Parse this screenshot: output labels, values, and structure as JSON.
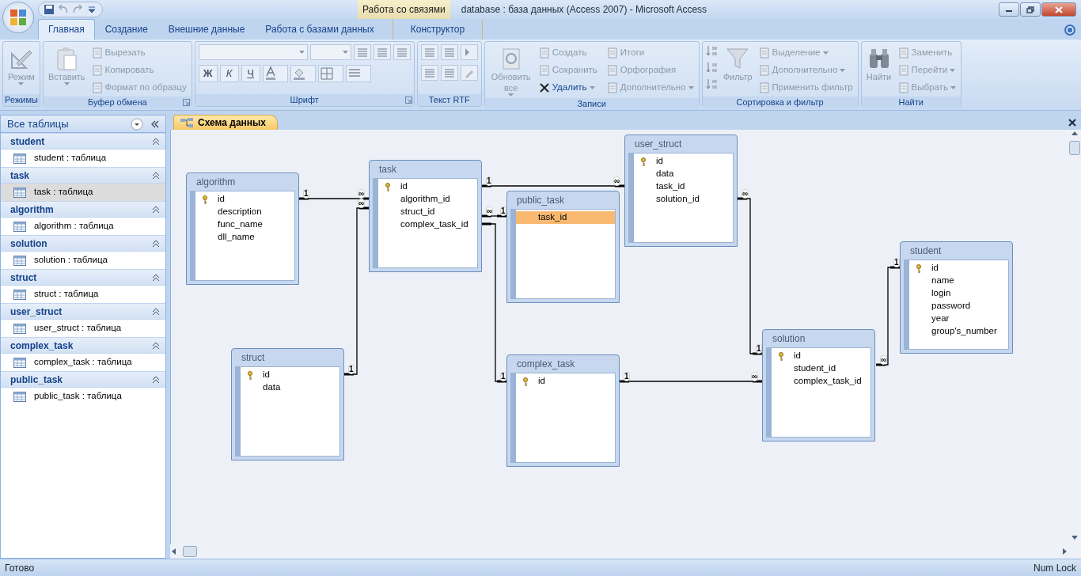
{
  "window": {
    "title": "database : база данных (Access 2007)  -  Microsoft Access",
    "context_tab": "Работа со связями"
  },
  "ribbon": {
    "tabs": [
      {
        "label": "Главная",
        "selected": true,
        "kind": "standard"
      },
      {
        "label": "Создание",
        "selected": false,
        "kind": "standard"
      },
      {
        "label": "Внешние данные",
        "selected": false,
        "kind": "standard"
      },
      {
        "label": "Работа с базами данных",
        "selected": false,
        "kind": "standard"
      },
      {
        "label": "Конструктор",
        "selected": false,
        "kind": "contextual"
      }
    ],
    "groups": [
      {
        "title": "Режимы",
        "kind": "commands",
        "launcher": false,
        "large": [
          {
            "label": "Режим",
            "disabled": true,
            "dropdown": true
          }
        ]
      },
      {
        "title": "Буфер обмена",
        "kind": "commands",
        "launcher": true,
        "large": [
          {
            "label": "Вставить",
            "disabled": true,
            "dropdown": true
          }
        ],
        "small": [
          {
            "label": "Вырезать",
            "disabled": true,
            "dropdown": false
          },
          {
            "label": "Копировать",
            "disabled": true,
            "dropdown": false
          },
          {
            "label": "Формат по образцу",
            "disabled": true,
            "dropdown": false
          }
        ]
      },
      {
        "title": "Шрифт",
        "kind": "font",
        "launcher": true,
        "format_buttons": [
          "Ж",
          "К",
          "Ч"
        ]
      },
      {
        "title": "Текст RTF",
        "kind": "rtf",
        "launcher": false
      },
      {
        "title": "Записи",
        "kind": "commands",
        "launcher": false,
        "large": [
          {
            "label": "Обновить все",
            "disabled": true,
            "dropdown": true
          }
        ],
        "small": [
          {
            "label": "Создать",
            "disabled": true,
            "dropdown": false
          },
          {
            "label": "Сохранить",
            "disabled": true,
            "dropdown": false
          },
          {
            "label": "Удалить",
            "disabled": false,
            "dropdown": true
          },
          {
            "label": "Итоги",
            "disabled": true,
            "dropdown": false
          },
          {
            "label": "Орфография",
            "disabled": true,
            "dropdown": false
          },
          {
            "label": "Дополнительно",
            "disabled": true,
            "dropdown": true
          }
        ]
      },
      {
        "title": "Сортировка и фильтр",
        "kind": "sort",
        "launcher": false,
        "large": [
          {
            "label": "Фильтр",
            "disabled": true,
            "dropdown": false
          }
        ],
        "small": [
          {
            "label": "Выделение",
            "disabled": true,
            "dropdown": true
          },
          {
            "label": "Дополнительно",
            "disabled": true,
            "dropdown": true
          },
          {
            "label": "Применить фильтр",
            "disabled": true,
            "dropdown": false
          }
        ]
      },
      {
        "title": "Найти",
        "kind": "commands",
        "launcher": false,
        "large": [
          {
            "label": "Найти",
            "disabled": true,
            "dropdown": false
          }
        ],
        "small": [
          {
            "label": "Заменить",
            "disabled": true,
            "dropdown": false
          },
          {
            "label": "Перейти",
            "disabled": true,
            "dropdown": true
          },
          {
            "label": "Выбрать",
            "disabled": true,
            "dropdown": true
          }
        ]
      }
    ]
  },
  "nav_pane": {
    "title": "Все таблицы",
    "groups": [
      {
        "name": "student",
        "items": [
          {
            "label": "student : таблица",
            "selected": false
          }
        ]
      },
      {
        "name": "task",
        "items": [
          {
            "label": "task : таблица",
            "selected": true
          }
        ]
      },
      {
        "name": "algorithm",
        "items": [
          {
            "label": "algorithm : таблица",
            "selected": false
          }
        ]
      },
      {
        "name": "solution",
        "items": [
          {
            "label": "solution : таблица",
            "selected": false
          }
        ]
      },
      {
        "name": "struct",
        "items": [
          {
            "label": "struct : таблица",
            "selected": false
          }
        ]
      },
      {
        "name": "user_struct",
        "items": [
          {
            "label": "user_struct : таблица",
            "selected": false
          }
        ]
      },
      {
        "name": "complex_task",
        "items": [
          {
            "label": "complex_task : таблица",
            "selected": false
          }
        ]
      },
      {
        "name": "public_task",
        "items": [
          {
            "label": "public_task : таблица",
            "selected": false
          }
        ]
      }
    ]
  },
  "document": {
    "tab": "Схема данных",
    "tables": [
      {
        "name": "algorithm",
        "fields": [
          {
            "name": "id",
            "key": true,
            "selected": false
          },
          {
            "name": "description",
            "key": false,
            "selected": false
          },
          {
            "name": "func_name",
            "key": false,
            "selected": false
          },
          {
            "name": "dll_name",
            "key": false,
            "selected": false
          }
        ]
      },
      {
        "name": "task",
        "fields": [
          {
            "name": "id",
            "key": true,
            "selected": false
          },
          {
            "name": "algorithm_id",
            "key": false,
            "selected": false
          },
          {
            "name": "struct_id",
            "key": false,
            "selected": false
          },
          {
            "name": "complex_task_id",
            "key": false,
            "selected": false
          }
        ]
      },
      {
        "name": "public_task",
        "fields": [
          {
            "name": "task_id",
            "key": false,
            "selected": true
          }
        ]
      },
      {
        "name": "user_struct",
        "fields": [
          {
            "name": "id",
            "key": true,
            "selected": false
          },
          {
            "name": "data",
            "key": false,
            "selected": false
          },
          {
            "name": "task_id",
            "key": false,
            "selected": false
          },
          {
            "name": "solution_id",
            "key": false,
            "selected": false
          }
        ]
      },
      {
        "name": "struct",
        "fields": [
          {
            "name": "id",
            "key": true,
            "selected": false
          },
          {
            "name": "data",
            "key": false,
            "selected": false
          }
        ]
      },
      {
        "name": "complex_task",
        "fields": [
          {
            "name": "id",
            "key": true,
            "selected": false
          }
        ]
      },
      {
        "name": "solution",
        "fields": [
          {
            "name": "id",
            "key": true,
            "selected": false
          },
          {
            "name": "student_id",
            "key": false,
            "selected": false
          },
          {
            "name": "complex_task_id",
            "key": false,
            "selected": false
          }
        ]
      },
      {
        "name": "student",
        "fields": [
          {
            "name": "id",
            "key": true,
            "selected": false
          },
          {
            "name": "name",
            "key": false,
            "selected": false
          },
          {
            "name": "login",
            "key": false,
            "selected": false
          },
          {
            "name": "password",
            "key": false,
            "selected": false
          },
          {
            "name": "year",
            "key": false,
            "selected": false
          },
          {
            "name": "group's_number",
            "key": false,
            "selected": false
          }
        ]
      }
    ],
    "relations": [
      {
        "start": "1",
        "end": "∞"
      },
      {
        "start": "1",
        "end": "∞"
      },
      {
        "start": "1",
        "end": "∞"
      },
      {
        "start": "∞",
        "end": "1"
      },
      {
        "end": "1"
      },
      {
        "start": "∞",
        "end": "1"
      },
      {
        "start": "1",
        "end": "∞"
      },
      {
        "start": "∞",
        "end": "1"
      }
    ]
  },
  "status_bar": {
    "left": "Готово",
    "right": "Num Lock"
  }
}
